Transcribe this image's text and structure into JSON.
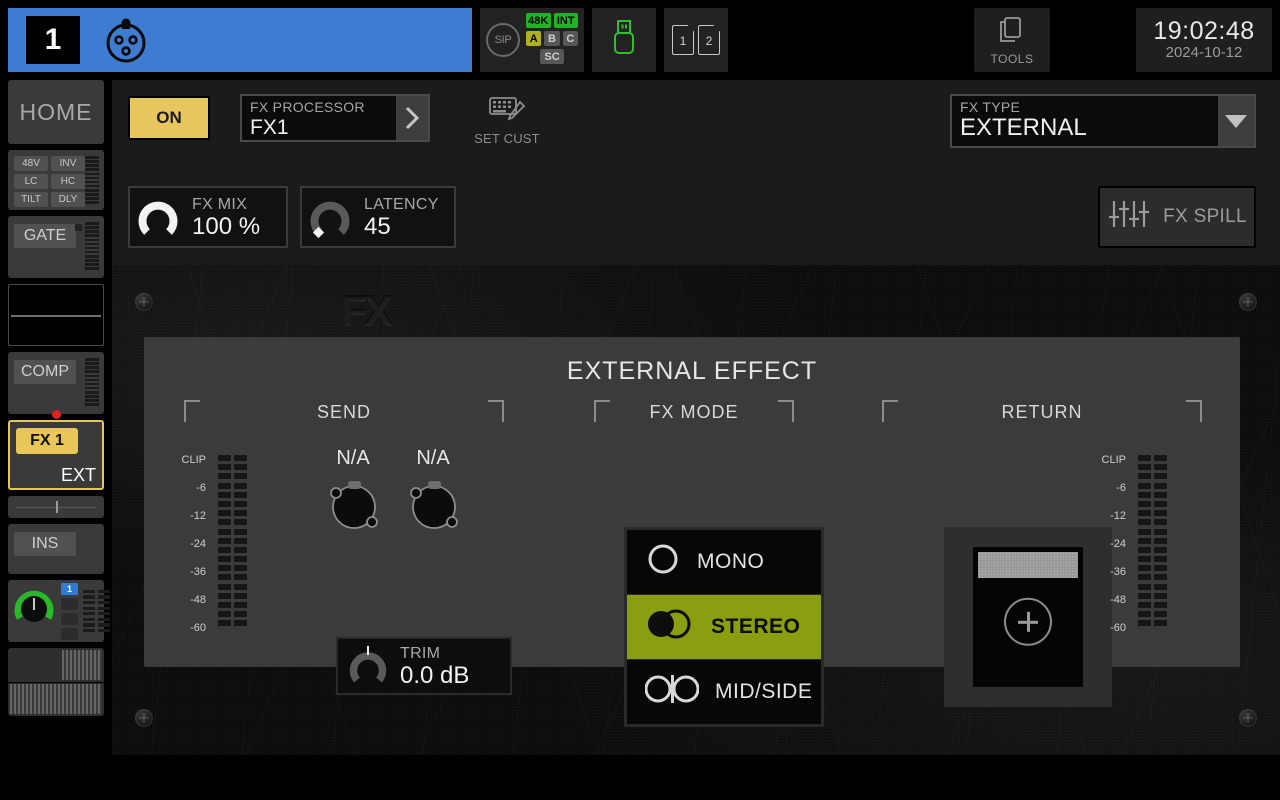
{
  "topbar": {
    "channel": {
      "number": "1",
      "icon": "xlr-connector-icon"
    },
    "status": {
      "sip_label": "SIP",
      "badges": [
        {
          "label": "48K",
          "state": "green"
        },
        {
          "label": "INT",
          "state": "green"
        },
        {
          "label": "A",
          "state": "olive"
        },
        {
          "label": "B",
          "state": "gray"
        },
        {
          "label": "C",
          "state": "gray"
        },
        {
          "label": "SC",
          "state": "gray"
        }
      ],
      "usb_icon": "usb-drive-icon",
      "usb_color": "#2fbf2f",
      "sd_cards": [
        "1",
        "2"
      ]
    },
    "tools": {
      "label": "TOOLS",
      "icon": "pages-icon"
    },
    "clock": {
      "time": "19:02:48",
      "date": "2024-10-12"
    }
  },
  "sidebar": {
    "home_label": "HOME",
    "preamp_buttons": [
      "48V",
      "INV",
      "LC",
      "HC",
      "TILT",
      "DLY"
    ],
    "gate_label": "GATE",
    "comp_label": "COMP",
    "fx_slot": {
      "tag": "FX 1",
      "mode": "EXT",
      "active": true,
      "accent": "#e8c659"
    },
    "ins_label": "INS",
    "bus_active": "1"
  },
  "fxbar": {
    "on_label": "ON",
    "on_color": "#e8c65e",
    "processor": {
      "label": "FX PROCESSOR",
      "value": "FX1",
      "arrow_icon": "chevron-right-icon"
    },
    "set_cust": {
      "label": "SET CUST",
      "icon": "keyboard-pen-icon"
    },
    "fx_type": {
      "label": "FX TYPE",
      "value": "EXTERNAL",
      "arrow_icon": "triangle-down-icon"
    },
    "fx_mix": {
      "label": "FX MIX",
      "value": "100 %",
      "knob_pct": 100
    },
    "latency": {
      "label": "LATENCY",
      "value": "45",
      "knob_pct": 8
    },
    "fx_spill": {
      "label": "FX SPILL",
      "icon": "faders-icon"
    }
  },
  "main": {
    "watermark": "FX",
    "title": "EXTERNAL EFFECT",
    "sections": {
      "send": {
        "header": "SEND"
      },
      "fx_mode": {
        "header": "FX MODE"
      },
      "return": {
        "header": "RETURN"
      }
    },
    "meter_scale": [
      "CLIP",
      "-6",
      "-12",
      "-24",
      "-36",
      "-48",
      "-60"
    ],
    "send": {
      "outputs": [
        {
          "label": "N/A",
          "icon": "output-connector-icon"
        },
        {
          "label": "N/A",
          "icon": "output-connector-icon"
        }
      ],
      "trim": {
        "label": "TRIM",
        "value": "0.0 dB",
        "knob_pct": 50
      }
    },
    "fx_mode_options": [
      {
        "label": "MONO",
        "icon": "mono-circle-icon",
        "selected": false
      },
      {
        "label": "STEREO",
        "icon": "stereo-circles-icon",
        "selected": true
      },
      {
        "label": "MID/SIDE",
        "icon": "mid-side-icon",
        "selected": false
      }
    ],
    "fx_mode_selected_color": "#8a9e10",
    "return": {
      "add_icon": "plus-circle-icon",
      "empty": true
    }
  }
}
